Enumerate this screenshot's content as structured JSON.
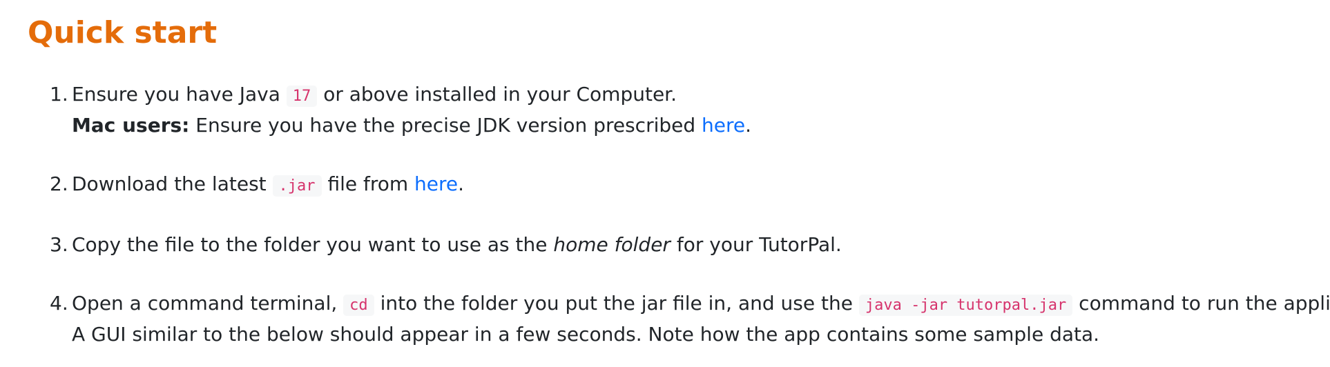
{
  "header": {
    "title": "Quick start"
  },
  "steps": [
    {
      "number": "1.",
      "line1_a": "Ensure you have Java",
      "code": "17",
      "line1_b": "or above installed in your Computer.",
      "bold": "Mac users:",
      "line2_a": "Ensure you have the precise JDK version prescribed",
      "link": "here",
      "line2_b": "."
    },
    {
      "number": "2.",
      "text_a": "Download the latest",
      "code": ".jar",
      "text_b": "file from",
      "link": "here",
      "text_c": "."
    },
    {
      "number": "3.",
      "text_a": "Copy the file to the folder you want to use as the",
      "italic": "home folder",
      "text_b": "for your TutorPal."
    },
    {
      "number": "4.",
      "text_a": "Open a command terminal,",
      "code1": "cd",
      "text_b": "into the folder you put the jar file in, and use the",
      "code2": "java -jar tutorpal.jar",
      "text_c": "command to run the application.",
      "line2": "A GUI similar to the below should appear in a few seconds. Note how the app contains some sample data."
    }
  ],
  "colors": {
    "title": "#e46c0a",
    "link": "#0d6efd",
    "code_text": "#d6336c",
    "code_bg": "#f6f7f8",
    "body_text": "#212529"
  }
}
